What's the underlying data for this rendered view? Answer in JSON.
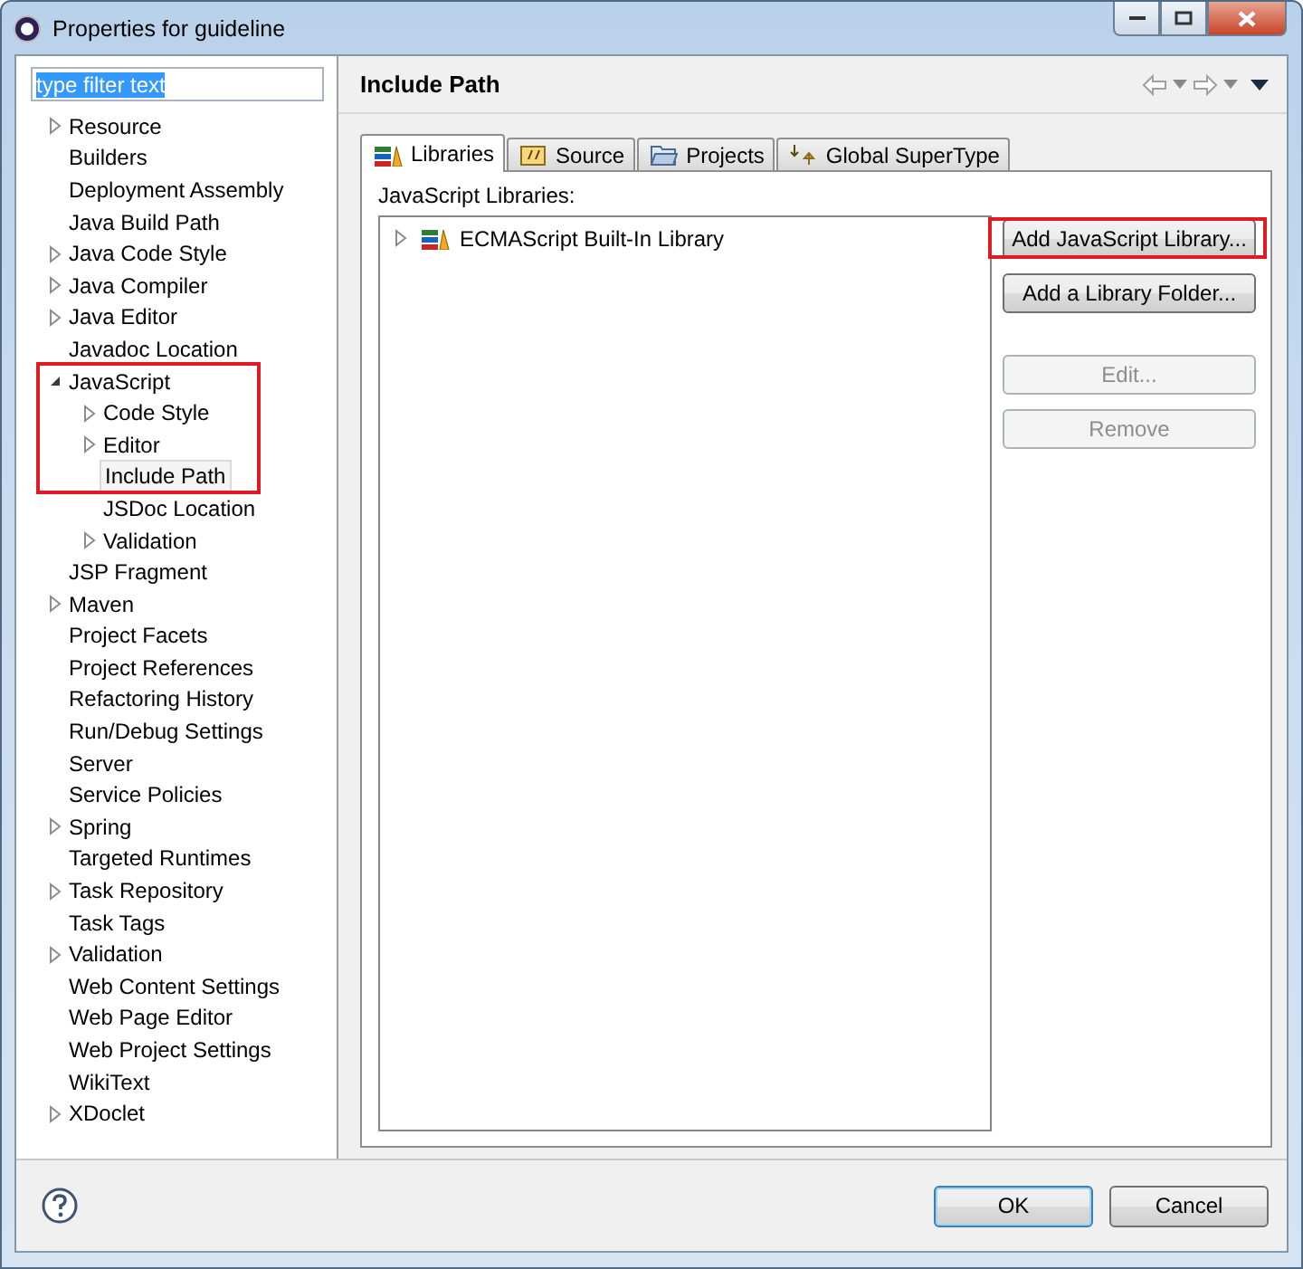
{
  "window": {
    "title": "Properties for guideline"
  },
  "filter": {
    "value": "type filter text"
  },
  "tree": [
    {
      "label": "Resource",
      "expandable": true,
      "expanded": false,
      "selected": false,
      "highlighted": false
    },
    {
      "label": "Builders",
      "expandable": false,
      "expanded": false,
      "selected": false,
      "highlighted": false
    },
    {
      "label": "Deployment Assembly",
      "expandable": false,
      "expanded": false,
      "selected": false,
      "highlighted": false
    },
    {
      "label": "Java Build Path",
      "expandable": false,
      "expanded": false,
      "selected": false,
      "highlighted": false
    },
    {
      "label": "Java Code Style",
      "expandable": true,
      "expanded": false,
      "selected": false,
      "highlighted": false
    },
    {
      "label": "Java Compiler",
      "expandable": true,
      "expanded": false,
      "selected": false,
      "highlighted": false
    },
    {
      "label": "Java Editor",
      "expandable": true,
      "expanded": false,
      "selected": false,
      "highlighted": false
    },
    {
      "label": "Javadoc Location",
      "expandable": false,
      "expanded": false,
      "selected": false,
      "highlighted": false
    },
    {
      "label": "JavaScript",
      "expandable": true,
      "expanded": true,
      "selected": false,
      "highlighted": true,
      "children": [
        {
          "label": "Code Style",
          "expandable": true,
          "expanded": false,
          "selected": false,
          "highlighted": true
        },
        {
          "label": "Editor",
          "expandable": true,
          "expanded": false,
          "selected": false,
          "highlighted": true
        },
        {
          "label": "Include Path",
          "expandable": false,
          "expanded": false,
          "selected": true,
          "highlighted": true
        },
        {
          "label": "JSDoc Location",
          "expandable": false,
          "expanded": false,
          "selected": false,
          "highlighted": false
        },
        {
          "label": "Validation",
          "expandable": true,
          "expanded": false,
          "selected": false,
          "highlighted": false
        }
      ]
    },
    {
      "label": "JSP Fragment",
      "expandable": false,
      "expanded": false,
      "selected": false,
      "highlighted": false
    },
    {
      "label": "Maven",
      "expandable": true,
      "expanded": false,
      "selected": false,
      "highlighted": false
    },
    {
      "label": "Project Facets",
      "expandable": false,
      "expanded": false,
      "selected": false,
      "highlighted": false
    },
    {
      "label": "Project References",
      "expandable": false,
      "expanded": false,
      "selected": false,
      "highlighted": false
    },
    {
      "label": "Refactoring History",
      "expandable": false,
      "expanded": false,
      "selected": false,
      "highlighted": false
    },
    {
      "label": "Run/Debug Settings",
      "expandable": false,
      "expanded": false,
      "selected": false,
      "highlighted": false
    },
    {
      "label": "Server",
      "expandable": false,
      "expanded": false,
      "selected": false,
      "highlighted": false
    },
    {
      "label": "Service Policies",
      "expandable": false,
      "expanded": false,
      "selected": false,
      "highlighted": false
    },
    {
      "label": "Spring",
      "expandable": true,
      "expanded": false,
      "selected": false,
      "highlighted": false
    },
    {
      "label": "Targeted Runtimes",
      "expandable": false,
      "expanded": false,
      "selected": false,
      "highlighted": false
    },
    {
      "label": "Task Repository",
      "expandable": true,
      "expanded": false,
      "selected": false,
      "highlighted": false
    },
    {
      "label": "Task Tags",
      "expandable": false,
      "expanded": false,
      "selected": false,
      "highlighted": false
    },
    {
      "label": "Validation",
      "expandable": true,
      "expanded": false,
      "selected": false,
      "highlighted": false
    },
    {
      "label": "Web Content Settings",
      "expandable": false,
      "expanded": false,
      "selected": false,
      "highlighted": false
    },
    {
      "label": "Web Page Editor",
      "expandable": false,
      "expanded": false,
      "selected": false,
      "highlighted": false
    },
    {
      "label": "Web Project Settings",
      "expandable": false,
      "expanded": false,
      "selected": false,
      "highlighted": false
    },
    {
      "label": "WikiText",
      "expandable": false,
      "expanded": false,
      "selected": false,
      "highlighted": false
    },
    {
      "label": "XDoclet",
      "expandable": true,
      "expanded": false,
      "selected": false,
      "highlighted": false
    }
  ],
  "page": {
    "title": "Include Path",
    "tabs": [
      {
        "label": "Libraries",
        "selected": true
      },
      {
        "label": "Source",
        "selected": false
      },
      {
        "label": "Projects",
        "selected": false
      },
      {
        "label": "Global SuperType",
        "selected": false
      }
    ],
    "list_label": "JavaScript Libraries:",
    "libraries": [
      {
        "label": "ECMAScript Built-In Library",
        "expanded": false
      }
    ],
    "buttons": [
      {
        "label": "Add JavaScript Library...",
        "disabled": false,
        "highlighted": true
      },
      {
        "label": "Add a Library Folder...",
        "disabled": false,
        "highlighted": false
      },
      {
        "label": "Edit...",
        "disabled": true,
        "highlighted": false
      },
      {
        "label": "Remove",
        "disabled": true,
        "highlighted": false
      }
    ]
  },
  "footer": {
    "buttons": [
      {
        "label": "OK",
        "default": true
      },
      {
        "label": "Cancel",
        "default": false
      }
    ]
  }
}
